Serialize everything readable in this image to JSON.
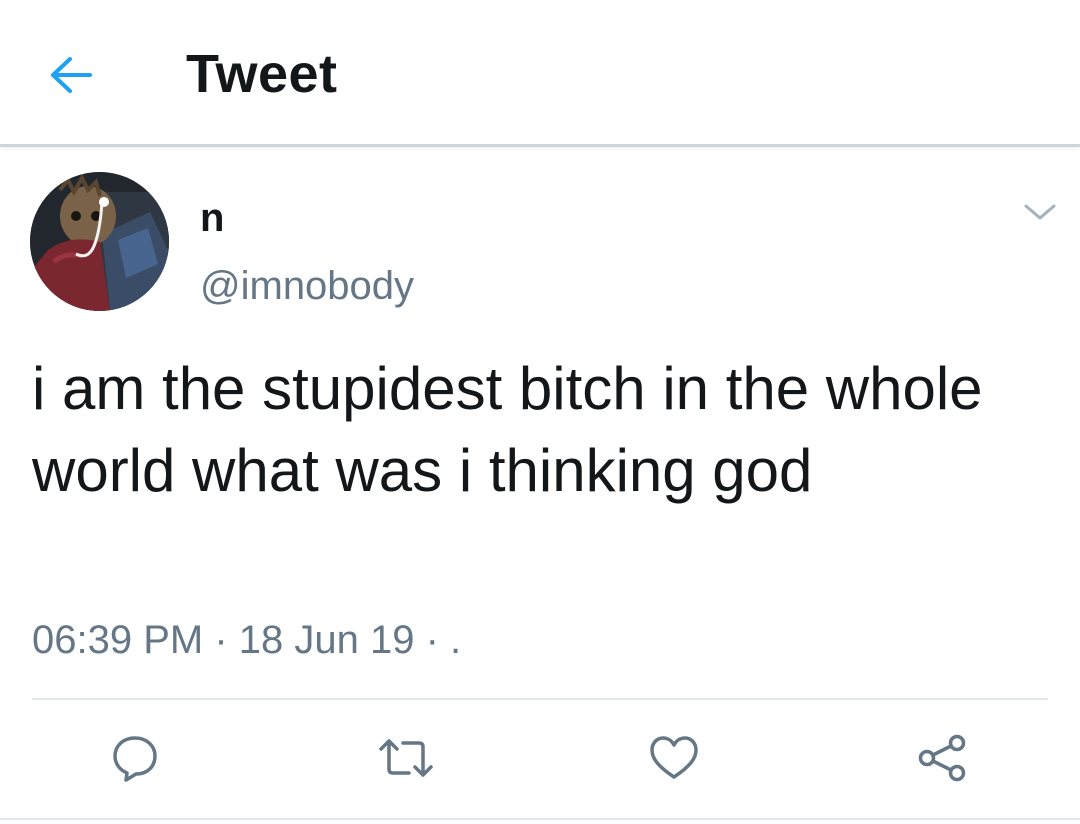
{
  "header": {
    "title": "Tweet",
    "back_icon": "arrow-left-icon",
    "accent_color": "#1da1f2"
  },
  "tweet": {
    "author": {
      "display_name": "n",
      "handle": "@imnobody",
      "avatar_icon": "profile-avatar"
    },
    "text": "i am the stupidest bitch in the whole world what was i thinking god",
    "time": "06:39 PM",
    "date": "18 Jun 19",
    "source": ".",
    "menu_icon": "chevron-down-icon"
  },
  "actions": [
    {
      "name": "reply",
      "icon": "reply-icon"
    },
    {
      "name": "retweet",
      "icon": "retweet-icon"
    },
    {
      "name": "like",
      "icon": "heart-icon"
    },
    {
      "name": "share",
      "icon": "share-icon"
    }
  ],
  "colors": {
    "text": "#14171a",
    "secondary": "#657786",
    "icon": "#657786",
    "divider": "#e1e8ed"
  }
}
